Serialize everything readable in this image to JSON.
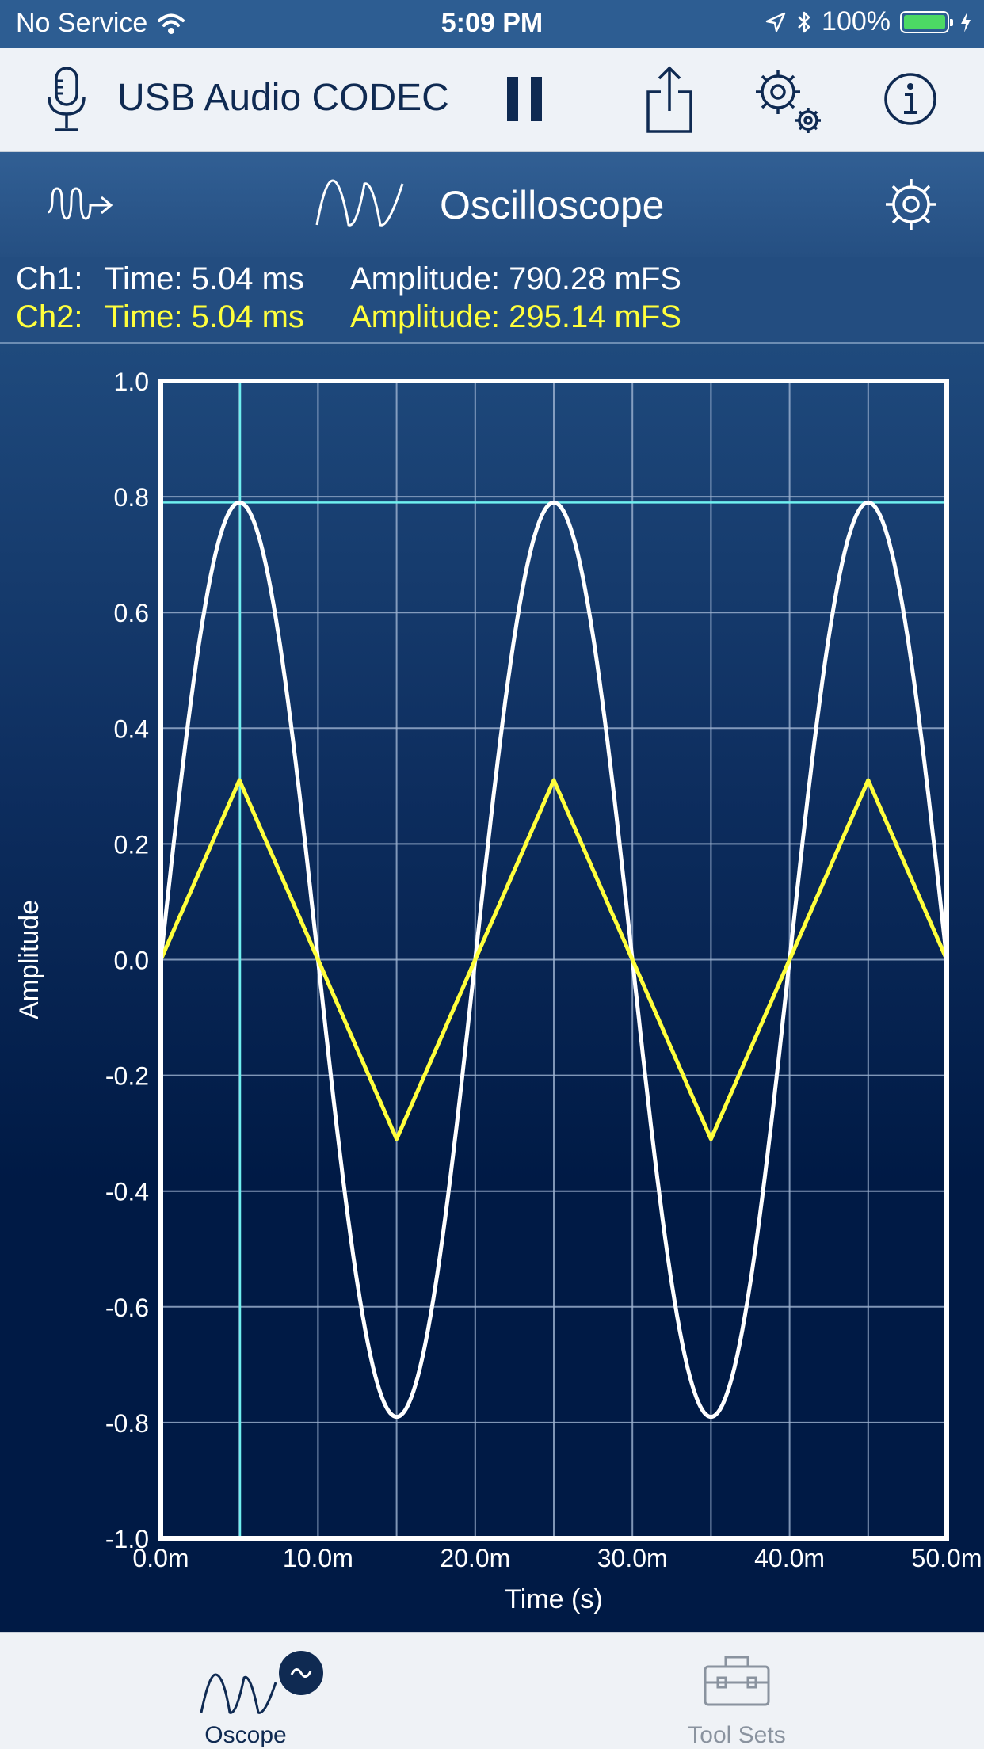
{
  "status_bar": {
    "carrier": "No Service",
    "time": "5:09 PM",
    "battery": "100%"
  },
  "toolbar": {
    "device_name": "USB Audio CODEC",
    "icons": [
      "microphone-icon",
      "pause-icon",
      "share-icon",
      "settings-gear-icon",
      "info-icon"
    ]
  },
  "mode_bar": {
    "title": "Oscilloscope",
    "icons": [
      "signal-route-icon",
      "waveform-icon",
      "settings-icon"
    ]
  },
  "readout": {
    "ch1": {
      "label": "Ch1:",
      "time": "Time: 5.04 ms",
      "amplitude": "Amplitude: 790.28 mFS"
    },
    "ch2": {
      "label": "Ch2:",
      "time": "Time: 5.04 ms",
      "amplitude": "Amplitude: 295.14 mFS"
    }
  },
  "colors": {
    "ch1": "#ffffff",
    "ch2": "#ffff3c",
    "cursor": "#6ff0f0",
    "grid": "#9fb4d2",
    "accent": "#0f2a52"
  },
  "chart_data": {
    "type": "line",
    "title": "",
    "xlabel": "Time (s)",
    "ylabel": "Amplitude",
    "xlim": [
      0,
      50
    ],
    "ylim": [
      -1.0,
      1.0
    ],
    "x_ticks": [
      "0.0m",
      "10.0m",
      "20.0m",
      "30.0m",
      "40.0m",
      "50.0m"
    ],
    "y_ticks": [
      "1.0",
      "0.8",
      "0.6",
      "0.4",
      "0.2",
      "0.0",
      "-0.2",
      "-0.4",
      "-0.6",
      "-0.8",
      "-1.0"
    ],
    "grid": true,
    "cursor": {
      "x": 5.04,
      "y": 0.79
    },
    "series": [
      {
        "name": "Ch1",
        "waveform": "sine",
        "amplitude": 0.79,
        "period": 20,
        "phase": 0,
        "points": [
          [
            0,
            0
          ],
          [
            5,
            0.79
          ],
          [
            10,
            0
          ],
          [
            15,
            -0.79
          ],
          [
            20,
            0
          ],
          [
            25,
            0.79
          ],
          [
            30,
            0
          ],
          [
            35,
            -0.79
          ],
          [
            40,
            0
          ],
          [
            45,
            0.79
          ],
          [
            50,
            0
          ]
        ]
      },
      {
        "name": "Ch2",
        "waveform": "triangle",
        "amplitude": 0.31,
        "period": 20,
        "phase": 0,
        "points": [
          [
            0,
            0
          ],
          [
            5,
            0.31
          ],
          [
            10,
            0
          ],
          [
            15,
            -0.31
          ],
          [
            20,
            0
          ],
          [
            25,
            0.31
          ],
          [
            30,
            0
          ],
          [
            35,
            -0.31
          ],
          [
            40,
            0
          ],
          [
            45,
            0.31
          ],
          [
            50,
            0
          ]
        ]
      }
    ]
  },
  "tab_bar": {
    "tabs": [
      {
        "label": "Oscope",
        "active": true,
        "icon": "oscilloscope-wave-icon"
      },
      {
        "label": "Tool Sets",
        "active": false,
        "icon": "toolbox-icon"
      }
    ]
  }
}
